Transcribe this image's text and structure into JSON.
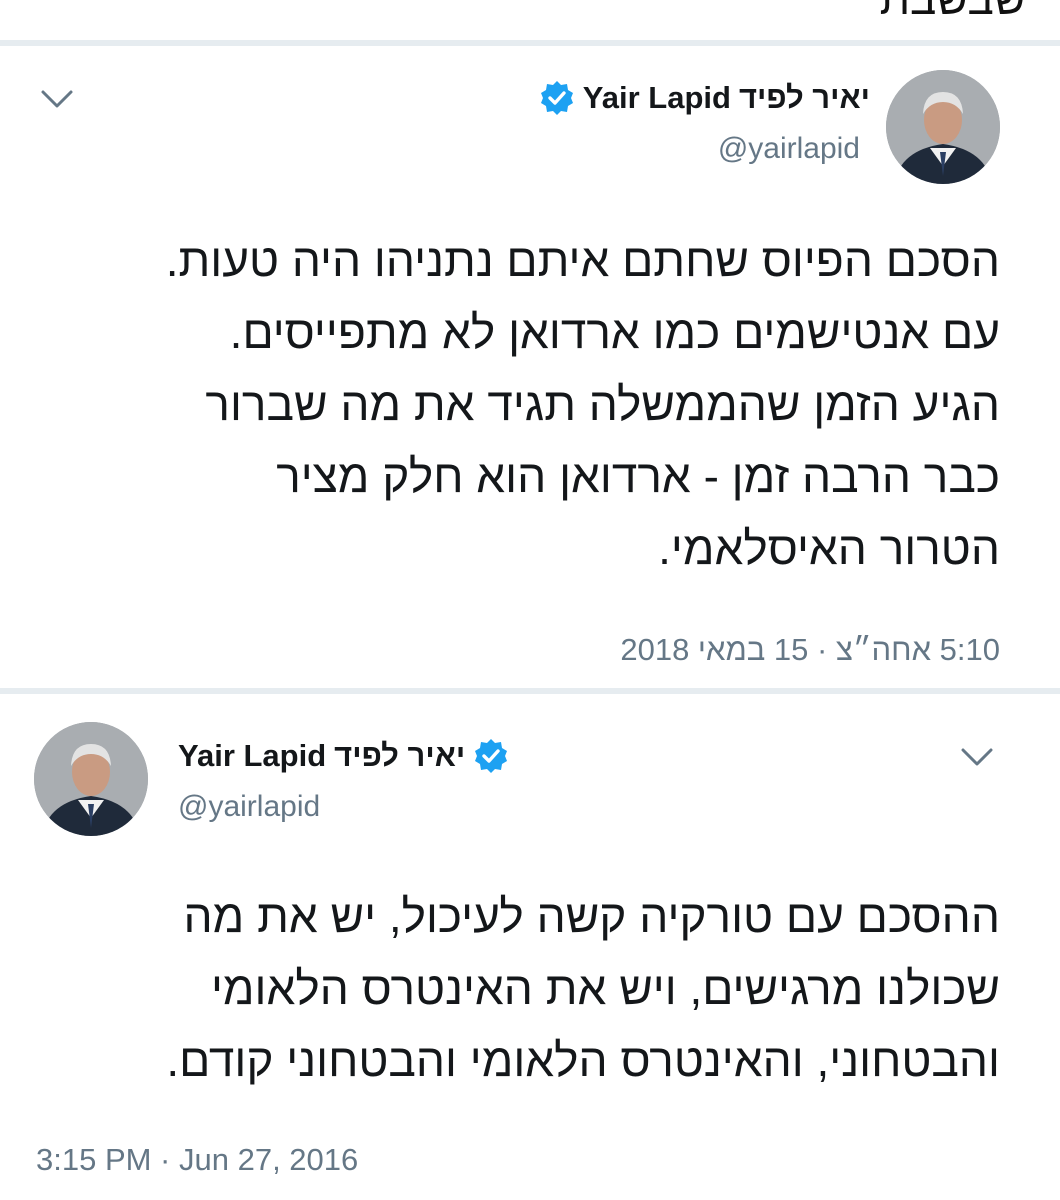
{
  "header_fragment": "שבשבת",
  "tweets": [
    {
      "author_name_hebrew": "יאיר לפיד",
      "author_name_english": "Yair Lapid",
      "handle": "@yairlapid",
      "lines": [
        "הסכם הפיוס שחתם איתם נתניהו היה טעות.",
        "עם אנטישמים כמו ארדואן לא מתפייסים.",
        "הגיע הזמן שהממשלה תגיד את מה שברור",
        "כבר הרבה זמן - ארדואן הוא חלק מציר",
        "הטרור האיסלאמי."
      ],
      "timestamp": "5:10 אחה״צ · 15 במאי 2018",
      "icons": {
        "verified": "verified-badge-icon",
        "menu": "chevron-down-icon"
      }
    },
    {
      "author_name_hebrew": "יאיר לפיד",
      "author_name_english": "Yair Lapid",
      "handle": "@yairlapid",
      "lines": [
        "ההסכם עם טורקיה קשה לעיכול, יש את מה",
        "שכולנו מרגישים, ויש את האינטרס הלאומי",
        "והבטחוני, והאינטרס הלאומי והבטחוני קודם."
      ],
      "timestamp": "3:15 PM · Jun 27, 2016",
      "icons": {
        "verified": "verified-badge-icon",
        "menu": "chevron-down-icon"
      }
    }
  ],
  "colors": {
    "verified_blue": "#1da1f2",
    "secondary_text": "#657786",
    "divider": "#e6ecf0"
  }
}
